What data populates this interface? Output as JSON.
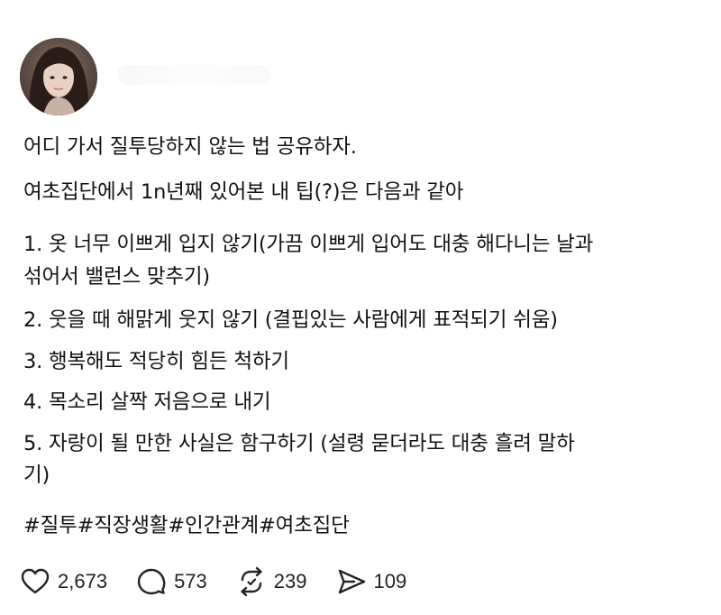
{
  "post": {
    "body_lines": [
      "어디 가서 질투당하지 않는 법 공유하자.",
      "여초집단에서 1n년째 있어본 내 팁(?)은 다음과 같아",
      "1. 옷 너무 이쁘게 입지 않기(가끔 이쁘게 입어도 대충 해다니는 날과",
      "섞어서 밸런스 맞추기)",
      "2. 웃을 때 해맑게 웃지 않기 (결핍있는 사람에게 표적되기 쉬움)",
      "3. 행복해도 적당히 힘든 척하기",
      "4. 목소리 살짝 저음으로 내기",
      "5. 자랑이 될 만한 사실은 함구하기 (설령 묻더라도 대충 흘려 말하",
      "기)"
    ],
    "hashtags": "#질투#직장생활#인간관계#여초집단"
  },
  "actions": {
    "like_icon": "heart-icon",
    "like_count": "2,673",
    "comment_icon": "comment-bubble-icon",
    "comment_count": "573",
    "repost_icon": "repost-icon",
    "repost_count": "239",
    "share_icon": "send-icon",
    "share_count": "109"
  }
}
